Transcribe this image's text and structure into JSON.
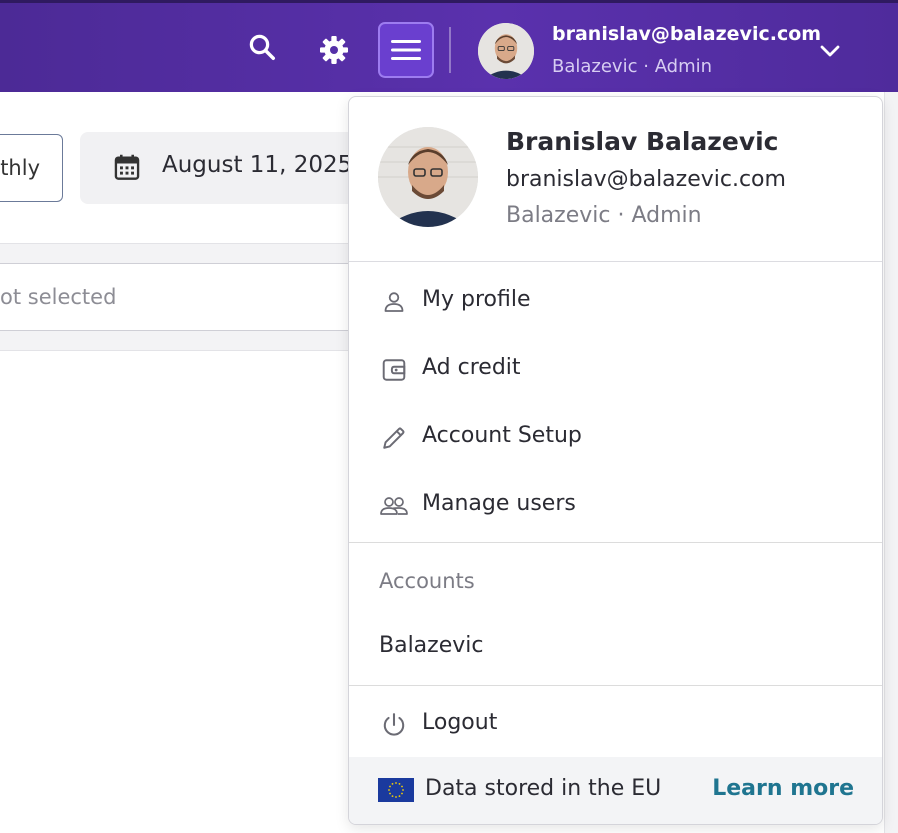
{
  "topbar": {
    "user_email": "branislav@balazevic.com",
    "user_org": "Balazevic",
    "separator": "·",
    "user_role": "Admin"
  },
  "background": {
    "period_button_fragment": "thly",
    "date_range_fragment": "August 11, 2025 -",
    "select_placeholder_fragment": "ot selected"
  },
  "dropdown": {
    "header": {
      "name": "Branislav Balazevic",
      "email": "branislav@balazevic.com",
      "org": "Balazevic",
      "separator": "·",
      "role": "Admin"
    },
    "menu_items": [
      {
        "label": "My profile",
        "icon": "person-icon"
      },
      {
        "label": "Ad credit",
        "icon": "wallet-icon"
      },
      {
        "label": "Account Setup",
        "icon": "pencil-icon"
      },
      {
        "label": "Manage users",
        "icon": "users-icon"
      }
    ],
    "accounts_title": "Accounts",
    "accounts": [
      "Balazevic"
    ],
    "logout_label": "Logout",
    "footer": {
      "text": "Data stored in the EU",
      "link": "Learn more"
    }
  },
  "colors": {
    "topbar": "#5230a3",
    "menu_button": "#6a3fcf",
    "link": "#1f7590",
    "eu_flag_blue": "#1a3a9e",
    "eu_flag_stars": "#f5d000"
  }
}
